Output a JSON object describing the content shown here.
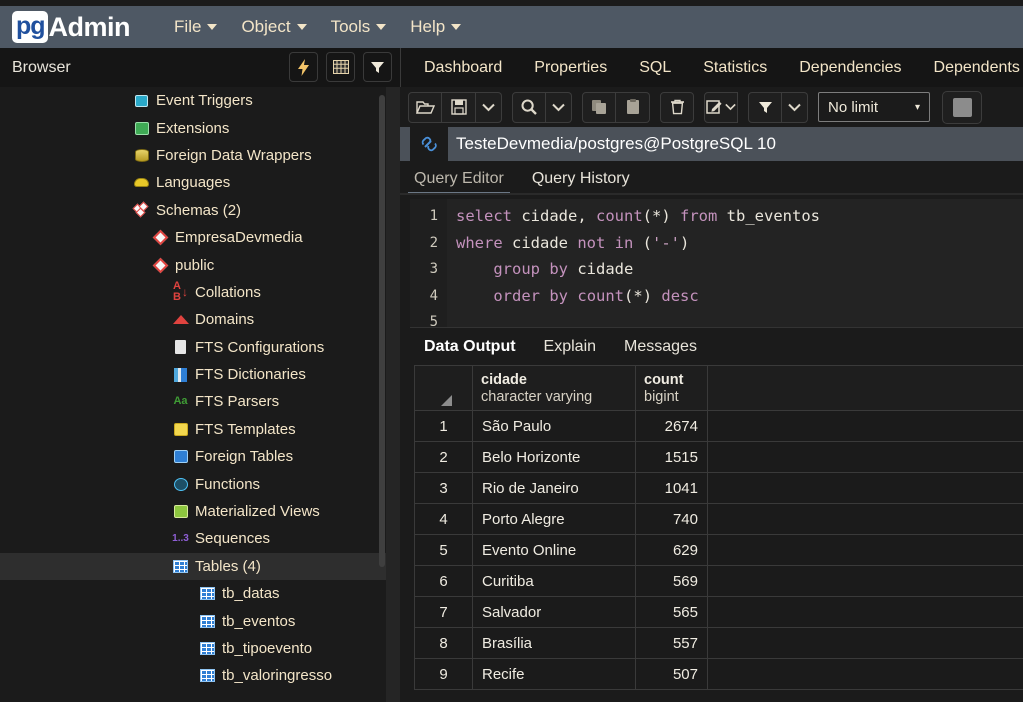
{
  "app": {
    "brand_pg": "pg",
    "brand_admin": "Admin"
  },
  "menubar": {
    "items": [
      {
        "label": "File",
        "icon": "chevron-down-icon"
      },
      {
        "label": "Object",
        "icon": "chevron-down-icon"
      },
      {
        "label": "Tools",
        "icon": "chevron-down-icon"
      },
      {
        "label": "Help",
        "icon": "chevron-down-icon"
      }
    ]
  },
  "browser": {
    "title": "Browser",
    "buttons": [
      {
        "name": "quick-action-icon",
        "glyph": "⚡"
      },
      {
        "name": "grid-view-icon",
        "glyph": "▦"
      },
      {
        "name": "filter-icon",
        "glyph": "▼"
      }
    ]
  },
  "object_tabs": [
    {
      "label": "Dashboard"
    },
    {
      "label": "Properties"
    },
    {
      "label": "SQL"
    },
    {
      "label": "Statistics"
    },
    {
      "label": "Dependencies"
    },
    {
      "label": "Dependents"
    }
  ],
  "tree": {
    "items": [
      {
        "label": "Event Triggers",
        "indent": 133,
        "icon": "event-trigger-icon",
        "selected": false
      },
      {
        "label": "Extensions",
        "indent": 133,
        "icon": "extension-icon",
        "selected": false
      },
      {
        "label": "Foreign Data Wrappers",
        "indent": 133,
        "icon": "foreign-data-wrapper-icon",
        "selected": false
      },
      {
        "label": "Languages",
        "indent": 133,
        "icon": "language-icon",
        "selected": false
      },
      {
        "label": "Schemas (2)",
        "indent": 133,
        "icon": "schemas-icon",
        "selected": false
      },
      {
        "label": "EmpresaDevmedia",
        "indent": 152,
        "icon": "schema-icon",
        "selected": false
      },
      {
        "label": "public",
        "indent": 152,
        "icon": "schema-icon",
        "selected": false
      },
      {
        "label": "Collations",
        "indent": 172,
        "icon": "collation-icon",
        "selected": false
      },
      {
        "label": "Domains",
        "indent": 172,
        "icon": "domain-icon",
        "selected": false
      },
      {
        "label": "FTS Configurations",
        "indent": 172,
        "icon": "fts-configuration-icon",
        "selected": false
      },
      {
        "label": "FTS Dictionaries",
        "indent": 172,
        "icon": "fts-dictionary-icon",
        "selected": false
      },
      {
        "label": "FTS Parsers",
        "indent": 172,
        "icon": "fts-parser-icon",
        "selected": false
      },
      {
        "label": "FTS Templates",
        "indent": 172,
        "icon": "fts-template-icon",
        "selected": false
      },
      {
        "label": "Foreign Tables",
        "indent": 172,
        "icon": "foreign-table-icon",
        "selected": false
      },
      {
        "label": "Functions",
        "indent": 172,
        "icon": "function-icon",
        "selected": false
      },
      {
        "label": "Materialized Views",
        "indent": 172,
        "icon": "materialized-view-icon",
        "selected": false
      },
      {
        "label": "Sequences",
        "indent": 172,
        "icon": "sequence-icon",
        "selected": false
      },
      {
        "label": "Tables (4)",
        "indent": 172,
        "icon": "tables-icon",
        "selected": true
      },
      {
        "label": "tb_datas",
        "indent": 199,
        "icon": "table-icon",
        "selected": false
      },
      {
        "label": "tb_eventos",
        "indent": 199,
        "icon": "table-icon",
        "selected": false
      },
      {
        "label": "tb_tipoevento",
        "indent": 199,
        "icon": "table-icon",
        "selected": false
      },
      {
        "label": "tb_valoringresso",
        "indent": 199,
        "icon": "table-icon",
        "selected": false
      }
    ]
  },
  "query_toolbar": {
    "buttons": [
      {
        "name": "open-file-button",
        "glyph": "🗁"
      },
      {
        "name": "save-file-button",
        "glyph": "💾"
      },
      {
        "name": "save-options-caret",
        "glyph": "⌄"
      },
      {
        "name": "find-button",
        "glyph": "🔍"
      },
      {
        "name": "find-options-caret",
        "glyph": "⌄"
      },
      {
        "name": "copy-button",
        "glyph": "❐"
      },
      {
        "name": "paste-button",
        "glyph": "❑"
      },
      {
        "name": "delete-button",
        "glyph": "🗑"
      },
      {
        "name": "edit-button",
        "glyph": "✎"
      },
      {
        "name": "edit-options-caret",
        "glyph": "⌄"
      },
      {
        "name": "filter-button",
        "glyph": "▼"
      },
      {
        "name": "filter-options-caret",
        "glyph": "⌄"
      }
    ],
    "row_limit": {
      "value": "No limit",
      "caret": "▾"
    },
    "stop_button": "stop-query-button"
  },
  "connection": {
    "icon": "connection-link-icon",
    "title": "TesteDevmedia/postgres@PostgreSQL 10"
  },
  "query_tabs": [
    {
      "label": "Query Editor",
      "active": true
    },
    {
      "label": "Query History",
      "active": false
    }
  ],
  "editor": {
    "line_numbers": [
      "1",
      "2",
      "3",
      "4",
      "5"
    ],
    "lines": [
      [
        {
          "t": "select",
          "c": "kw"
        },
        {
          "t": " cidade, ",
          "c": ""
        },
        {
          "t": "count",
          "c": "kw"
        },
        {
          "t": "(*) ",
          "c": ""
        },
        {
          "t": "from",
          "c": "kw"
        },
        {
          "t": " tb_eventos",
          "c": ""
        }
      ],
      [
        {
          "t": "where",
          "c": "kw"
        },
        {
          "t": " cidade ",
          "c": ""
        },
        {
          "t": "not",
          "c": "kw"
        },
        {
          "t": " ",
          "c": ""
        },
        {
          "t": "in",
          "c": "kw"
        },
        {
          "t": " (",
          "c": ""
        },
        {
          "t": "'-'",
          "c": "str"
        },
        {
          "t": ")",
          "c": ""
        }
      ],
      [
        {
          "t": "    ",
          "c": ""
        },
        {
          "t": "group",
          "c": "kw"
        },
        {
          "t": " ",
          "c": ""
        },
        {
          "t": "by",
          "c": "kw"
        },
        {
          "t": " cidade",
          "c": ""
        }
      ],
      [
        {
          "t": "    ",
          "c": ""
        },
        {
          "t": "order",
          "c": "kw"
        },
        {
          "t": " ",
          "c": ""
        },
        {
          "t": "by",
          "c": "kw"
        },
        {
          "t": " ",
          "c": ""
        },
        {
          "t": "count",
          "c": "kw"
        },
        {
          "t": "(*) ",
          "c": ""
        },
        {
          "t": "desc",
          "c": "kw"
        }
      ],
      []
    ]
  },
  "output_tabs": [
    {
      "label": "Data Output",
      "active": true
    },
    {
      "label": "Explain",
      "active": false
    },
    {
      "label": "Messages",
      "active": false
    }
  ],
  "results": {
    "columns": [
      {
        "name": "",
        "type": ""
      },
      {
        "name": "cidade",
        "type": "character varying"
      },
      {
        "name": "count",
        "type": "bigint"
      }
    ],
    "rows": [
      {
        "num": "1",
        "cidade": "São Paulo",
        "count": "2674"
      },
      {
        "num": "2",
        "cidade": "Belo Horizonte",
        "count": "1515"
      },
      {
        "num": "3",
        "cidade": "Rio de Janeiro",
        "count": "1041"
      },
      {
        "num": "4",
        "cidade": "Porto Alegre",
        "count": "740"
      },
      {
        "num": "5",
        "cidade": "Evento Online",
        "count": "629"
      },
      {
        "num": "6",
        "cidade": "Curitiba",
        "count": "569"
      },
      {
        "num": "7",
        "cidade": "Salvador",
        "count": "565"
      },
      {
        "num": "8",
        "cidade": "Brasília",
        "count": "557"
      },
      {
        "num": "9",
        "cidade": "Recife",
        "count": "507"
      }
    ]
  },
  "colors": {
    "menubar_bg": "#4e5864",
    "panel_bg": "#1b1b1b",
    "accent_text": "#f3e5c8",
    "selected_row": "#2e2e2e",
    "sql_keyword": "#c492bd",
    "connection_bar": "#4b5159"
  }
}
